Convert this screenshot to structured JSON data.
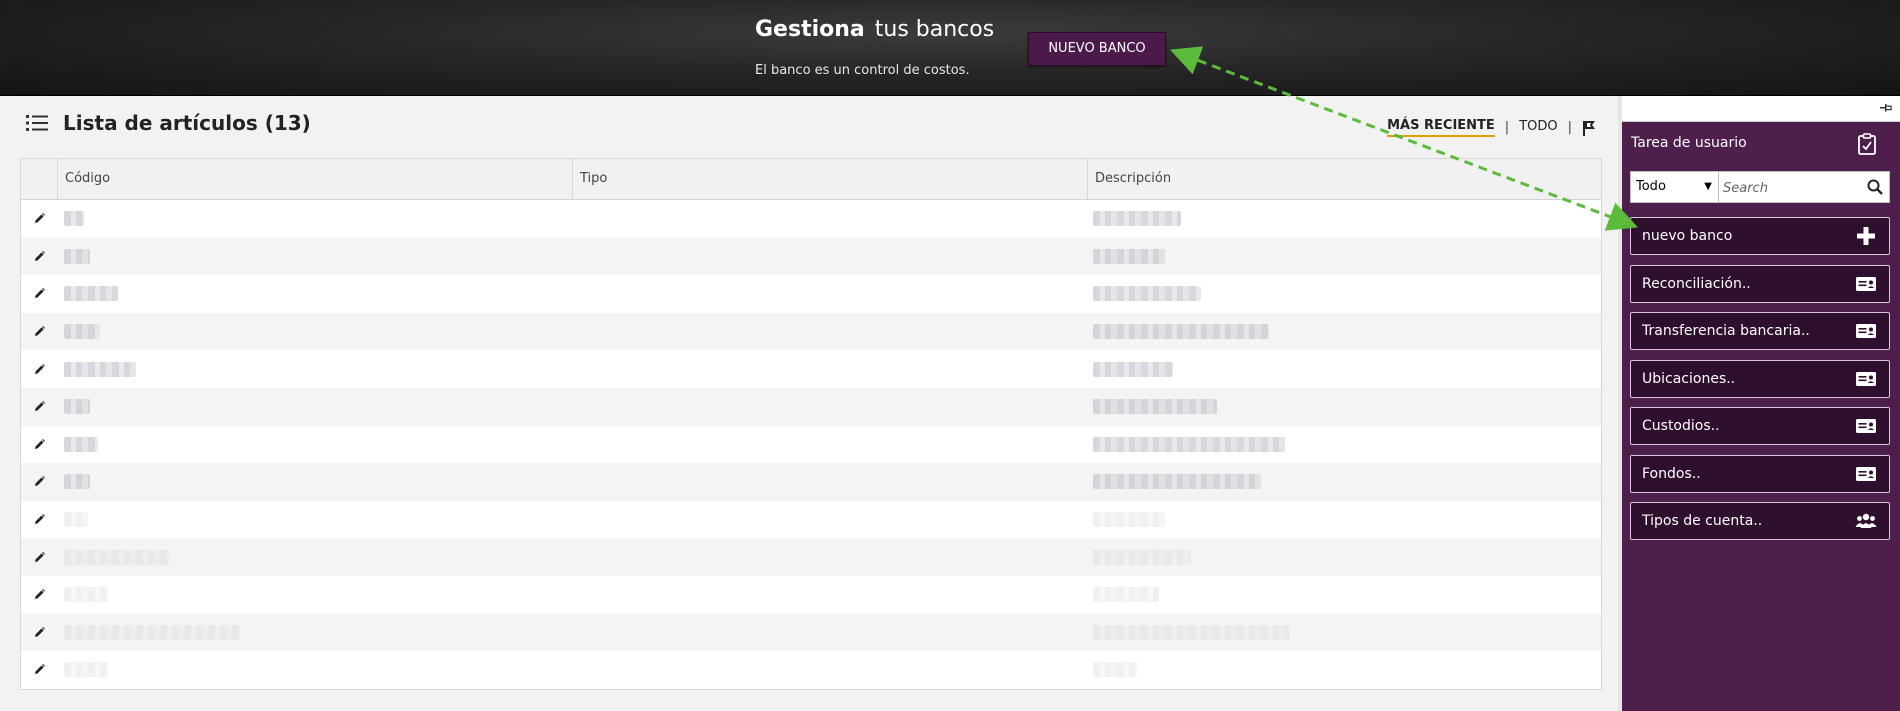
{
  "banner": {
    "title_bold": "Gestiona",
    "title_rest": "tus bancos",
    "subtitle": "El banco es un control de costos.",
    "new_button": "NUEVO BANCO"
  },
  "list": {
    "title": "Lista de artículos (13)",
    "filters": {
      "recent": "MÁS RECIENTE",
      "all": "TODO",
      "separator": "|"
    },
    "columns": [
      "",
      "Código",
      "Tipo",
      "Descripción"
    ],
    "rows": [
      {
        "code_w": 20,
        "desc_w": 88
      },
      {
        "code_w": 26,
        "desc_w": 72
      },
      {
        "code_w": 54,
        "desc_w": 108
      },
      {
        "code_w": 36,
        "desc_w": 176
      },
      {
        "code_w": 72,
        "desc_w": 80
      },
      {
        "code_w": 26,
        "desc_w": 124
      },
      {
        "code_w": 34,
        "desc_w": 192
      },
      {
        "code_w": 26,
        "desc_w": 168
      },
      {
        "code_w": 24,
        "desc_w": 72,
        "faint": true
      },
      {
        "code_w": 106,
        "desc_w": 98,
        "faint": true
      },
      {
        "code_w": 44,
        "desc_w": 66,
        "faint": true
      },
      {
        "code_w": 176,
        "desc_w": 196,
        "faint": true
      },
      {
        "code_w": 44,
        "desc_w": 44,
        "faint": true
      }
    ]
  },
  "sidebar": {
    "title": "Tarea de usuario",
    "select_value": "Todo",
    "search_placeholder": "Search",
    "tasks": [
      {
        "label": "nuevo banco",
        "icon": "plus-icon"
      },
      {
        "label": "Reconciliación..",
        "icon": "id-card-icon"
      },
      {
        "label": "Transferencia bancaria..",
        "icon": "id-card-icon"
      },
      {
        "label": "Ubicaciones..",
        "icon": "id-card-icon"
      },
      {
        "label": "Custodios..",
        "icon": "id-card-icon"
      },
      {
        "label": "Fondos..",
        "icon": "id-card-icon"
      },
      {
        "label": "Tipos de cuenta..",
        "icon": "users-icon"
      }
    ]
  },
  "colors": {
    "banner_bg": "#1a1a1a",
    "accent_purple": "#4b1a4a",
    "sidebar_bg": "#4e1f4c",
    "task_btn_bg": "#2f0f2e",
    "filter_underline": "#e0a000",
    "arrow": "#5dbb3c"
  }
}
